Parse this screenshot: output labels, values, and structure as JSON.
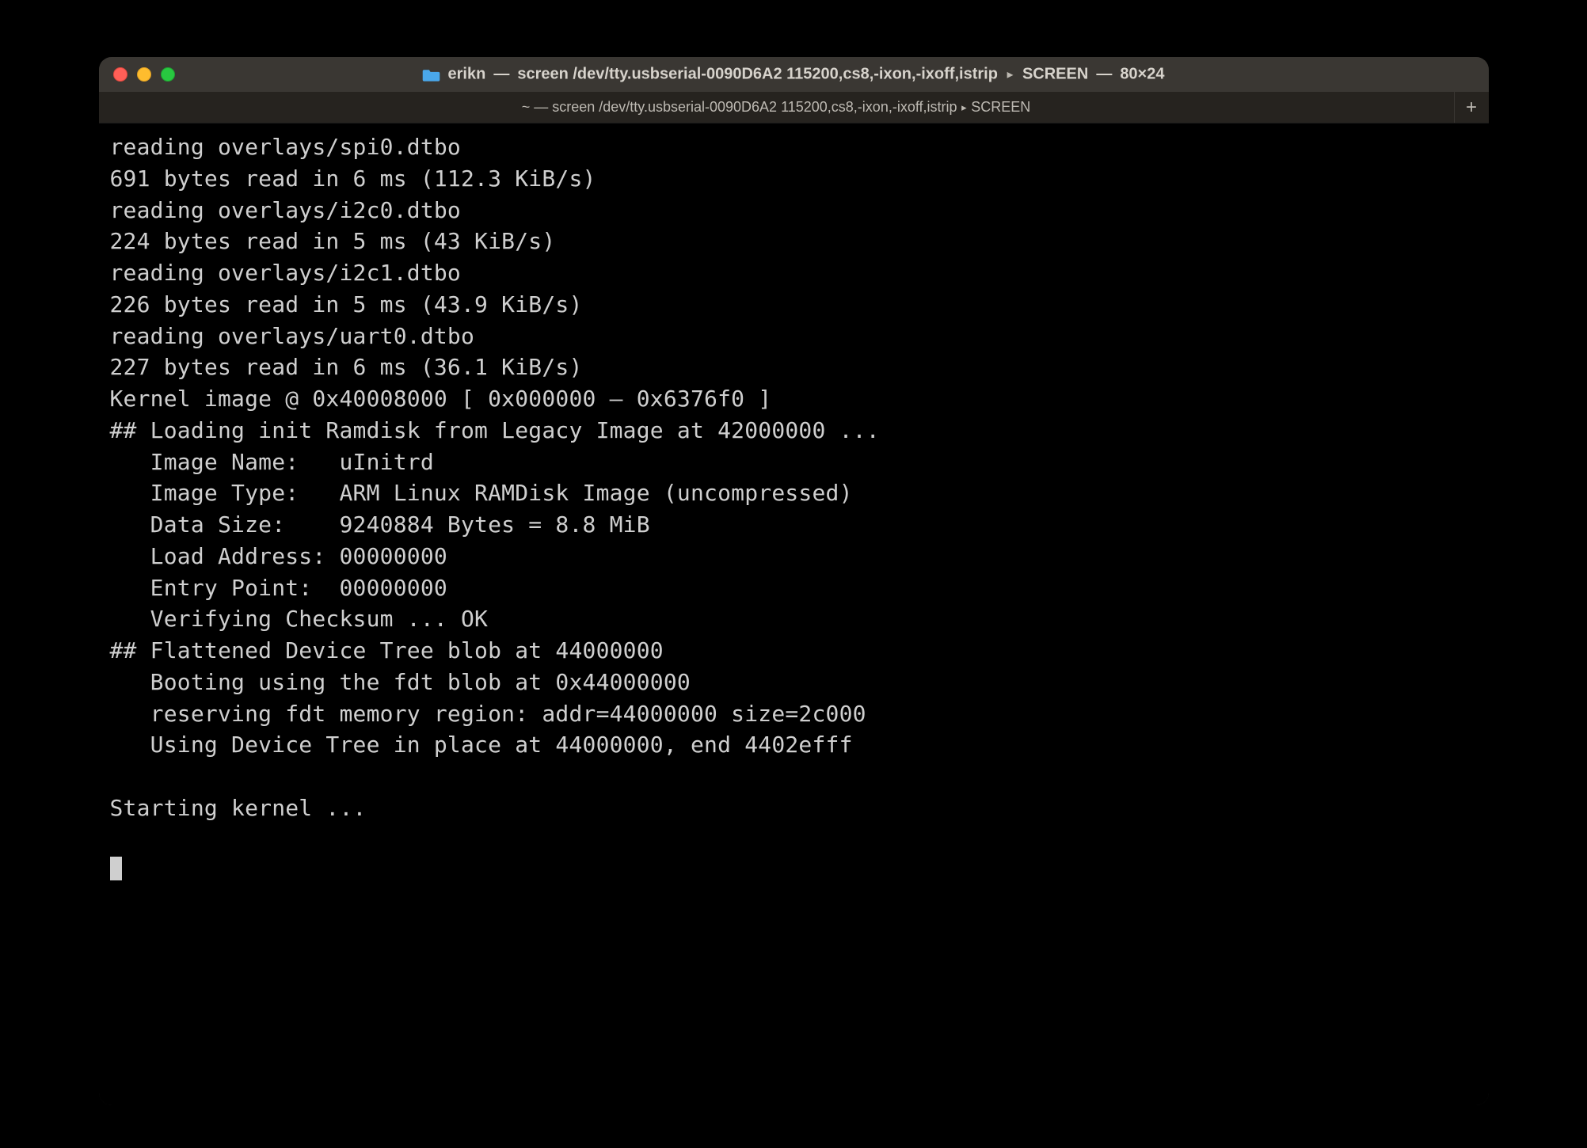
{
  "window": {
    "title_user": "erikn",
    "title_app": "screen /dev/tty.usbserial-0090D6A2 115200,cs8,-ixon,-ixoff,istrip",
    "title_proc": "SCREEN",
    "title_dims": "80×24"
  },
  "tab": {
    "cwd": "~",
    "app": "screen /dev/tty.usbserial-0090D6A2 115200,cs8,-ixon,-ixoff,istrip",
    "proc": "SCREEN"
  },
  "terminal_lines": [
    "reading overlays/spi0.dtbo",
    "691 bytes read in 6 ms (112.3 KiB/s)",
    "reading overlays/i2c0.dtbo",
    "224 bytes read in 5 ms (43 KiB/s)",
    "reading overlays/i2c1.dtbo",
    "226 bytes read in 5 ms (43.9 KiB/s)",
    "reading overlays/uart0.dtbo",
    "227 bytes read in 6 ms (36.1 KiB/s)",
    "Kernel image @ 0x40008000 [ 0x000000 – 0x6376f0 ]",
    "## Loading init Ramdisk from Legacy Image at 42000000 ...",
    "   Image Name:   uInitrd",
    "   Image Type:   ARM Linux RAMDisk Image (uncompressed)",
    "   Data Size:    9240884 Bytes = 8.8 MiB",
    "   Load Address: 00000000",
    "   Entry Point:  00000000",
    "   Verifying Checksum ... OK",
    "## Flattened Device Tree blob at 44000000",
    "   Booting using the fdt blob at 0x44000000",
    "   reserving fdt memory region: addr=44000000 size=2c000",
    "   Using Device Tree in place at 44000000, end 4402efff",
    "",
    "Starting kernel ...",
    ""
  ]
}
